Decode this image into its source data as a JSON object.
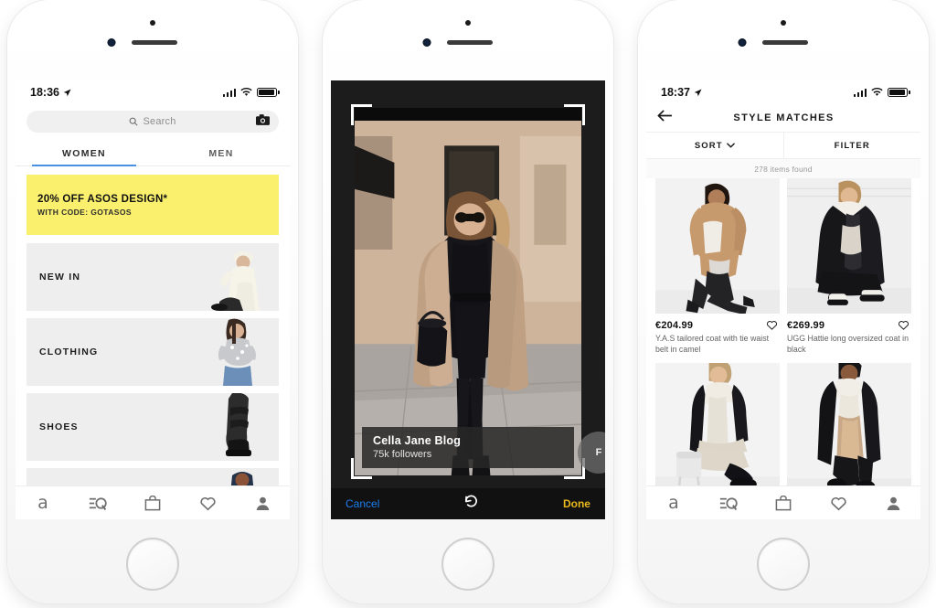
{
  "accent_colors": {
    "tab_underline": "#4a90e2",
    "promo_background": "#faf06e",
    "cancel_blue": "#1e7ef0",
    "done_yellow": "#e8b81c",
    "category_tile": "#eeeeee"
  },
  "phone1": {
    "status": {
      "time": "18:36",
      "location_icon": "location-arrow-icon"
    },
    "search": {
      "placeholder": "Search",
      "camera_icon": "camera-icon",
      "search_icon": "search-icon"
    },
    "tabs": [
      {
        "label": "WOMEN",
        "active": true
      },
      {
        "label": "MEN",
        "active": false
      }
    ],
    "promo": {
      "headline": "20% OFF ASOS DESIGN*",
      "subline": "WITH CODE: GOTASOS"
    },
    "categories": [
      {
        "label": "NEW IN"
      },
      {
        "label": "CLOTHING"
      },
      {
        "label": "SHOES"
      },
      {
        "label": ""
      }
    ],
    "tabbar": [
      {
        "icon": "asos-logo-icon",
        "glyph": "a"
      },
      {
        "icon": "search-discover-icon"
      },
      {
        "icon": "shopping-bag-icon"
      },
      {
        "icon": "heart-icon"
      },
      {
        "icon": "account-person-icon"
      }
    ]
  },
  "phone2": {
    "viewfinder": {
      "brackets": "crop-corner-brackets"
    },
    "creator": {
      "name": "Cella Jane Blog",
      "followers": "75k followers",
      "follow_button": "F"
    },
    "toolbar": {
      "cancel_label": "Cancel",
      "rotate_icon": "undo-rotate-icon",
      "done_label": "Done"
    }
  },
  "phone3": {
    "status": {
      "time": "18:37",
      "location_icon": "location-arrow-icon"
    },
    "header": {
      "back_icon": "back-arrow-icon",
      "title": "STYLE MATCHES"
    },
    "filters": {
      "sort_label": "SORT",
      "sort_chevron": "chevron-down-icon",
      "filter_label": "FILTER"
    },
    "results_count": "278 items found",
    "products": [
      {
        "price": "€204.99",
        "name": "Y.A.S tailored coat with tie waist belt in camel",
        "wishlist_icon": "heart-icon"
      },
      {
        "price": "€269.99",
        "name": "UGG Hattie long oversized coat in black",
        "wishlist_icon": "heart-icon"
      },
      {
        "price": "",
        "name": "",
        "wishlist_icon": "heart-icon"
      },
      {
        "price": "",
        "name": "",
        "wishlist_icon": "heart-icon"
      }
    ],
    "tabbar": [
      {
        "icon": "asos-logo-icon",
        "glyph": "a"
      },
      {
        "icon": "search-discover-icon"
      },
      {
        "icon": "shopping-bag-icon"
      },
      {
        "icon": "heart-icon"
      },
      {
        "icon": "account-person-icon"
      }
    ]
  }
}
